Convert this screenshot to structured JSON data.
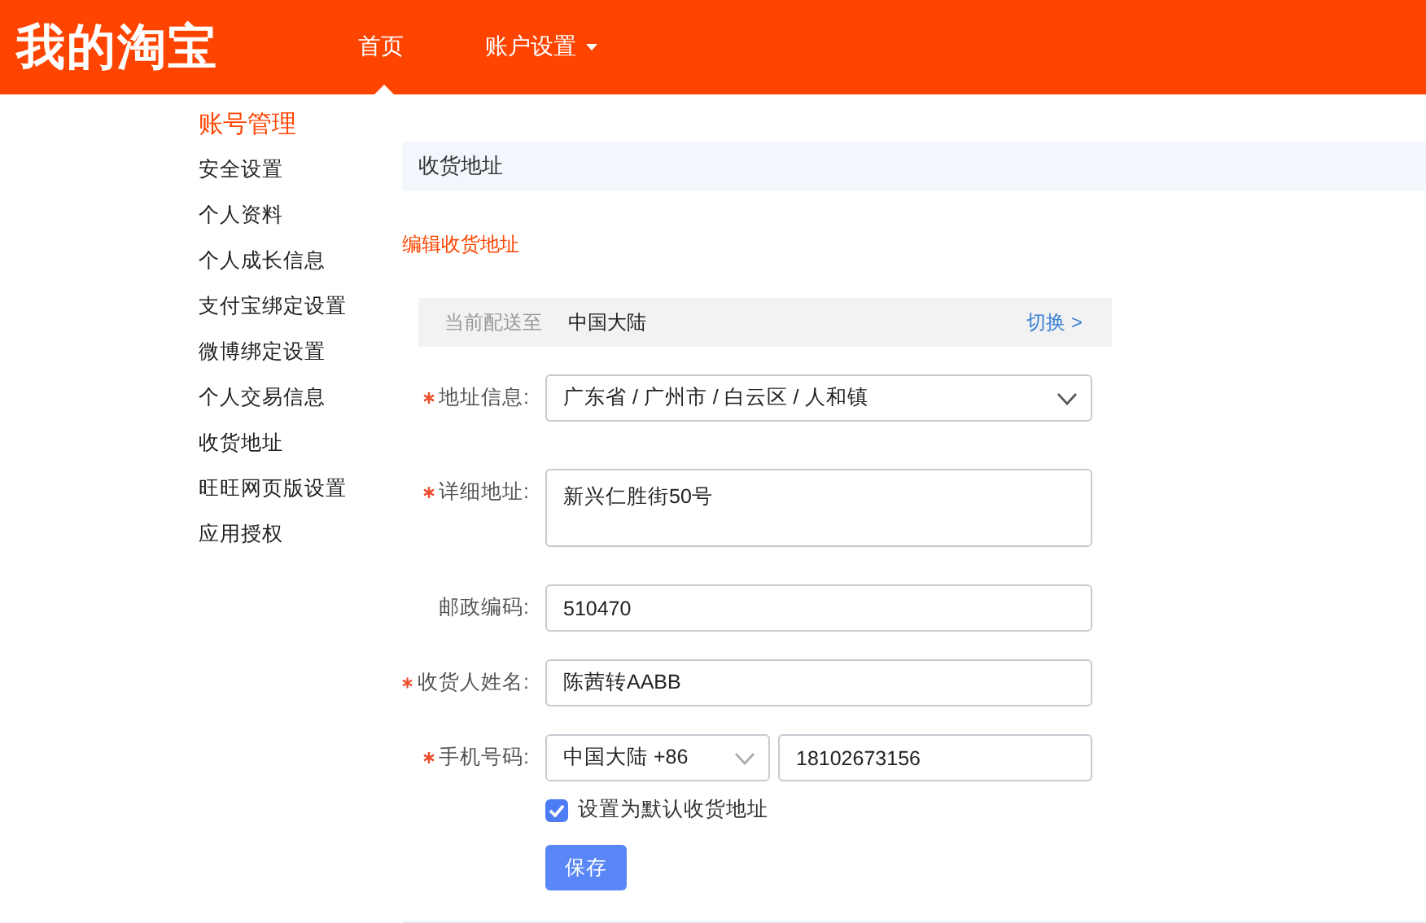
{
  "header": {
    "logo": "我的淘宝",
    "nav": [
      {
        "label": "首页",
        "selected": true,
        "dropdown": false
      },
      {
        "label": "账户设置",
        "selected": false,
        "dropdown": true
      }
    ]
  },
  "sidebar": {
    "heading": "账号管理",
    "items": [
      {
        "label": "安全设置"
      },
      {
        "label": "个人资料"
      },
      {
        "label": "个人成长信息"
      },
      {
        "label": "支付宝绑定设置"
      },
      {
        "label": "微博绑定设置"
      },
      {
        "label": "个人交易信息"
      },
      {
        "label": "收货地址"
      },
      {
        "label": "旺旺网页版设置"
      },
      {
        "label": "应用授权"
      }
    ]
  },
  "section_title": "收货地址",
  "subtitle": "编辑收货地址",
  "delivery": {
    "label": "当前配送至",
    "region": "中国大陆",
    "switch_link": "切换 >"
  },
  "form": {
    "fields": [
      {
        "kind": "cascader",
        "label": "地址信息:",
        "required": true,
        "value": "广东省 / 广州市 / 白云区 / 人和镇"
      },
      {
        "kind": "textarea",
        "label": "详细地址:",
        "required": true,
        "value": "新兴仁胜街50号"
      },
      {
        "kind": "input",
        "label": "邮政编码:",
        "required": false,
        "value": "510470"
      },
      {
        "kind": "input",
        "label": "收货人姓名:",
        "required": true,
        "value": "陈茜转AABB"
      },
      {
        "kind": "phone",
        "label": "手机号码:",
        "required": true,
        "country": "中国大陆 +86",
        "value": "18102673156"
      }
    ],
    "default_checkbox": {
      "label": "设置为默认收货地址",
      "checked": true
    },
    "save_button": "保存"
  }
}
